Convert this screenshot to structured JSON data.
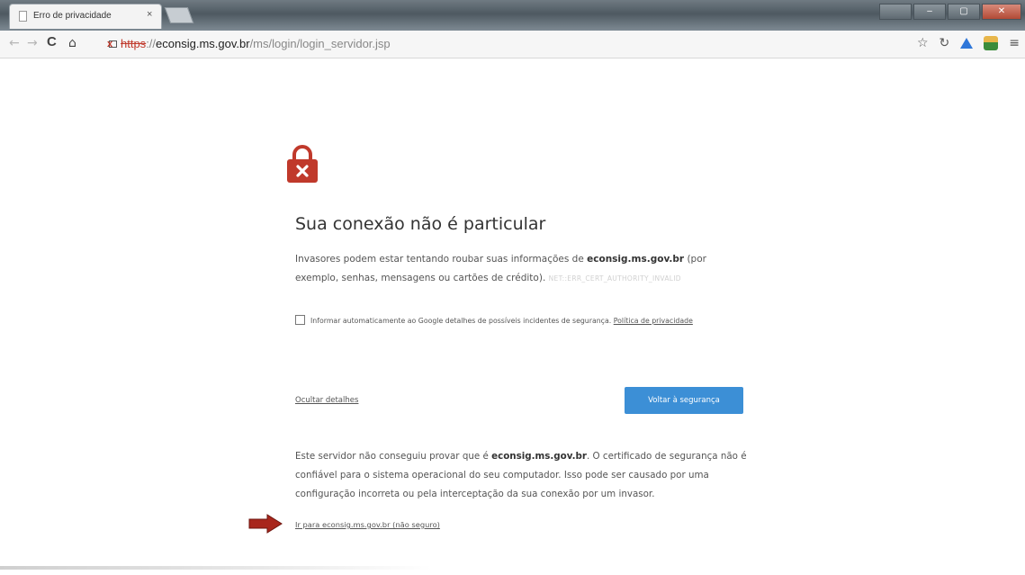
{
  "browser": {
    "tab_title": "Erro de privacidade",
    "tab_close": "×",
    "url": {
      "scheme": "https",
      "separator": "://",
      "host": "econsig.ms.gov.br",
      "path": "/ms/login/login_servidor.jsp"
    }
  },
  "interstitial": {
    "headline": "Sua conexão não é particular",
    "explanation": {
      "prefix": "Invasores podem estar tentando roubar suas informações de ",
      "host": "econsig.ms.gov.br",
      "suffix": " (por exemplo, senhas, mensagens ou cartões de crédito). ",
      "error_code": "NET::ERR_CERT_AUTHORITY_INVALID"
    },
    "report": {
      "text": "Informar automaticamente ao Google detalhes de possíveis incidentes de segurança. ",
      "policy_link": "Política de privacidade",
      "checked": false
    },
    "hide_details_link": "Ocultar detalhes",
    "primary_button": "Voltar à segurança",
    "details": {
      "prefix": "Este servidor não conseguiu provar que é ",
      "host": "econsig.ms.gov.br",
      "suffix": ". O certificado de segurança não é confiável para o sistema operacional do seu computador. Isso pode ser causado por uma configuração incorreta ou pela interceptação da sua conexão por um invasor."
    },
    "proceed_link": "Ir para econsig.ms.gov.br (não seguro)"
  },
  "colors": {
    "padlock": "#c0392b",
    "primary_button": "#3c8fd6",
    "arrow": "#a8261c"
  },
  "icons": [
    "broken-lock-icon",
    "star-icon",
    "extension-icon",
    "drive-icon",
    "avatar-icon",
    "menu-icon",
    "padlock-x-icon",
    "red-arrow-icon"
  ]
}
